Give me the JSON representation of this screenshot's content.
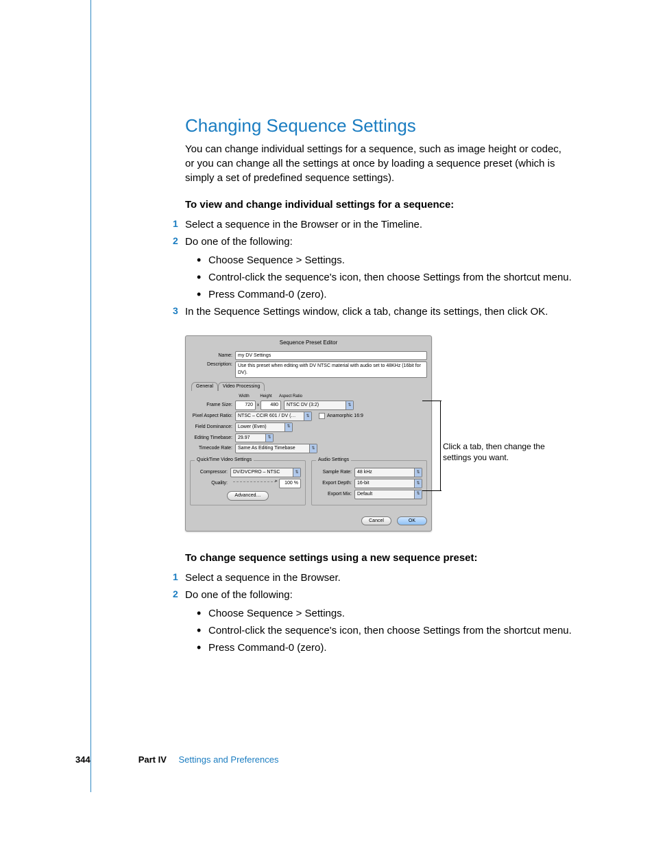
{
  "heading": "Changing Sequence Settings",
  "intro": "You can change individual settings for a sequence, such as image height or codec, or you can change all the settings at once by loading a sequence preset (which is simply a set of predefined sequence settings).",
  "task1": {
    "title": "To view and change individual settings for a sequence:",
    "steps": [
      "Select a sequence in the Browser or in the Timeline.",
      "Do one of the following:",
      "In the Sequence Settings window, click a tab, change its settings, then click OK."
    ],
    "sub2": [
      "Choose Sequence > Settings.",
      "Control-click the sequence's icon, then choose Settings from the shortcut menu.",
      "Press Command-0 (zero)."
    ]
  },
  "dialog": {
    "title": "Sequence Preset Editor",
    "name_label": "Name:",
    "name_value": "my DV Settings",
    "desc_label": "Description:",
    "desc_value": "Use this preset when editing with DV NTSC material with audio set to 48KHz (16bit for DV).",
    "tabs": {
      "general": "General",
      "video_processing": "Video Processing"
    },
    "headers": {
      "width": "Width",
      "height": "Height",
      "aspect": "Aspect Ratio"
    },
    "frame_size_label": "Frame Size:",
    "frame_w": "720",
    "frame_x": "x",
    "frame_h": "480",
    "aspect_value": "NTSC DV (3:2)",
    "par_label": "Pixel Aspect Ratio:",
    "par_value": "NTSC – CCIR 601 / DV (…",
    "anamorphic": "Anamorphic 16:9",
    "fd_label": "Field Dominance:",
    "fd_value": "Lower (Even)",
    "etb_label": "Editing Timebase:",
    "etb_value": "29.97",
    "tc_label": "Timecode Rate:",
    "tc_value": "Same As Editing Timebase",
    "qt_title": "QuickTime Video Settings",
    "compressor_label": "Compressor:",
    "compressor_value": "DV/DVCPRO – NTSC",
    "quality_label": "Quality:",
    "quality_value": "100 %",
    "advanced": "Advanced…",
    "audio_title": "Audio Settings",
    "sr_label": "Sample Rate:",
    "sr_value": "48 kHz",
    "ed_label": "Export Depth:",
    "ed_value": "16-bit",
    "em_label": "Export Mix:",
    "em_value": "Default",
    "cancel": "Cancel",
    "ok": "OK"
  },
  "callout": "Click a tab, then change the settings you want.",
  "task2": {
    "title": "To change sequence settings using a new sequence preset:",
    "steps": [
      "Select a sequence in the Browser.",
      "Do one of the following:"
    ],
    "sub2": [
      "Choose Sequence > Settings.",
      "Control-click the sequence's icon, then choose Settings from the shortcut menu.",
      "Press Command-0 (zero)."
    ]
  },
  "footer": {
    "page": "344",
    "part": "Part IV",
    "section": "Settings and Preferences"
  }
}
